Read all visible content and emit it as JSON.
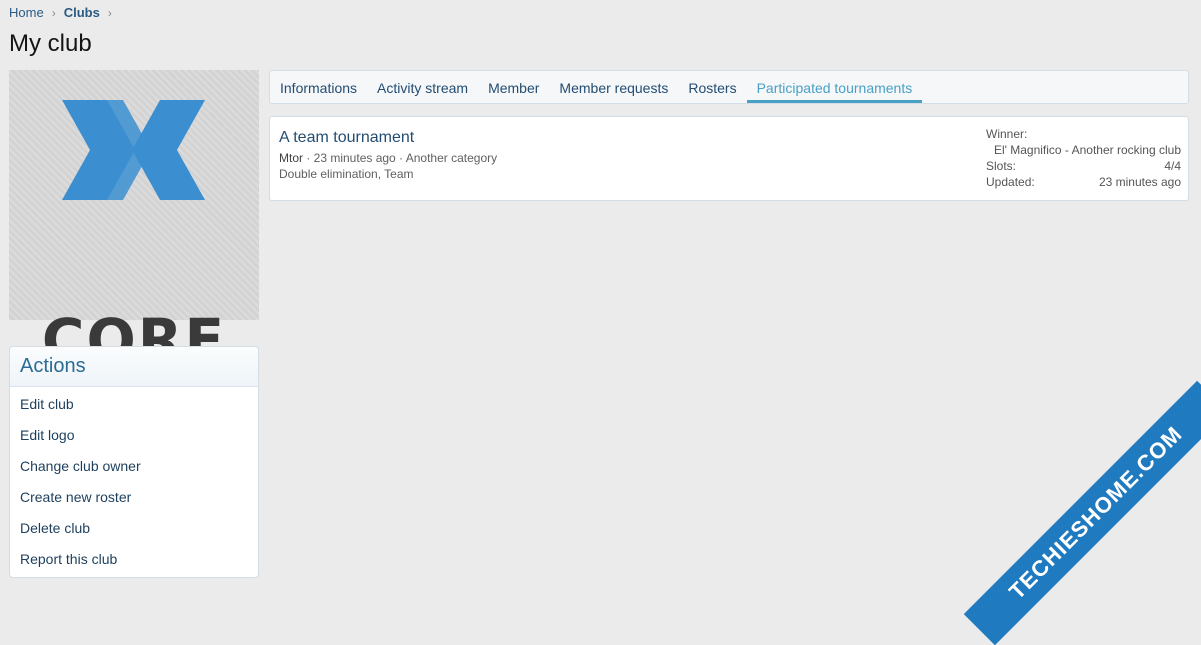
{
  "breadcrumb": {
    "home": "Home",
    "clubs": "Clubs",
    "sep": "›"
  },
  "page": {
    "title": "My club"
  },
  "logo": {
    "text": "CORE",
    "accent": "#3b8fd1"
  },
  "actions": {
    "title": "Actions",
    "items": [
      "Edit club",
      "Edit logo",
      "Change club owner",
      "Create new roster",
      "Delete club",
      "Report this club"
    ]
  },
  "tabs": [
    {
      "label": "Informations"
    },
    {
      "label": "Activity stream"
    },
    {
      "label": "Member"
    },
    {
      "label": "Member requests"
    },
    {
      "label": "Rosters"
    },
    {
      "label": "Participated tournaments"
    }
  ],
  "tournament": {
    "title": "A team tournament",
    "author": "Mtor",
    "meta": " · 23 minutes ago · Another category",
    "tags": "Double elimination, Team",
    "winner_label": "Winner:",
    "winner_value": "El' Magnifico - Another rocking club",
    "slots_label": "Slots:",
    "slots_value": "4/4",
    "updated_label": "Updated:",
    "updated_value": "23 minutes ago"
  },
  "watermark": {
    "text": "TECHIESHOME.COM",
    "color": "#1f7ac0"
  }
}
